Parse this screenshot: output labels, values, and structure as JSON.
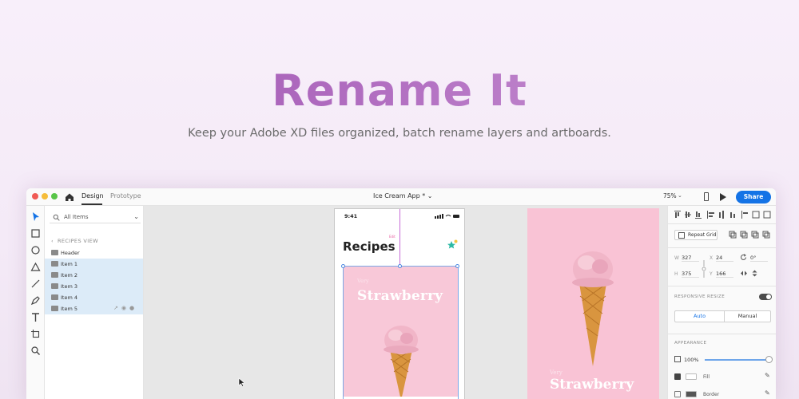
{
  "hero": {
    "title": "Rename It",
    "subtitle": "Keep your Adobe XD files organized, batch rename layers and artboards."
  },
  "titlebar": {
    "tabs": [
      "Design",
      "Prototype"
    ],
    "active_tab": "Design",
    "document_title": "Ice Cream App *  ⌄",
    "zoom": "75%",
    "share_label": "Share"
  },
  "toolbar": {
    "tools": [
      "select-tool-icon",
      "rectangle-tool-icon",
      "ellipse-tool-icon",
      "polygon-tool-icon",
      "line-tool-icon",
      "pen-tool-icon",
      "text-tool-icon",
      "artboard-tool-icon",
      "zoom-tool-icon"
    ]
  },
  "layers": {
    "filter": "All Items",
    "back_label": "RECIPES VIEW",
    "items": [
      {
        "label": "Header",
        "selected": false
      },
      {
        "label": "Item 1",
        "selected": true
      },
      {
        "label": "Item 2",
        "selected": true
      },
      {
        "label": "Item 3",
        "selected": true
      },
      {
        "label": "Item 4",
        "selected": true
      },
      {
        "label": "Item 5",
        "selected": true
      }
    ]
  },
  "canvas": {
    "app_artboard": {
      "status_time": "9:41",
      "title": "Recipes",
      "tiny_label": "Edit",
      "card_kicker": "Very",
      "card_title": "Strawberry"
    },
    "photo_artboard": {
      "kicker": "Very",
      "title": "Strawberry"
    }
  },
  "inspector": {
    "repeat_grid_label": "Repeat Grid",
    "w_label": "W",
    "w_value": "327",
    "h_label": "H",
    "h_value": "375",
    "x_label": "X",
    "x_value": "24",
    "y_label": "Y",
    "y_value": "166",
    "rotation_value": "0°",
    "responsive_label": "RESPONSIVE RESIZE",
    "resize_auto": "Auto",
    "resize_manual": "Manual",
    "appearance_label": "APPEARANCE",
    "opacity": "100%",
    "fill_label": "Fill",
    "border_label": "Border"
  },
  "colors": {
    "accent": "#1473e6",
    "brand_purple": "#a55bb7",
    "card_pink": "#f8c8d8"
  }
}
